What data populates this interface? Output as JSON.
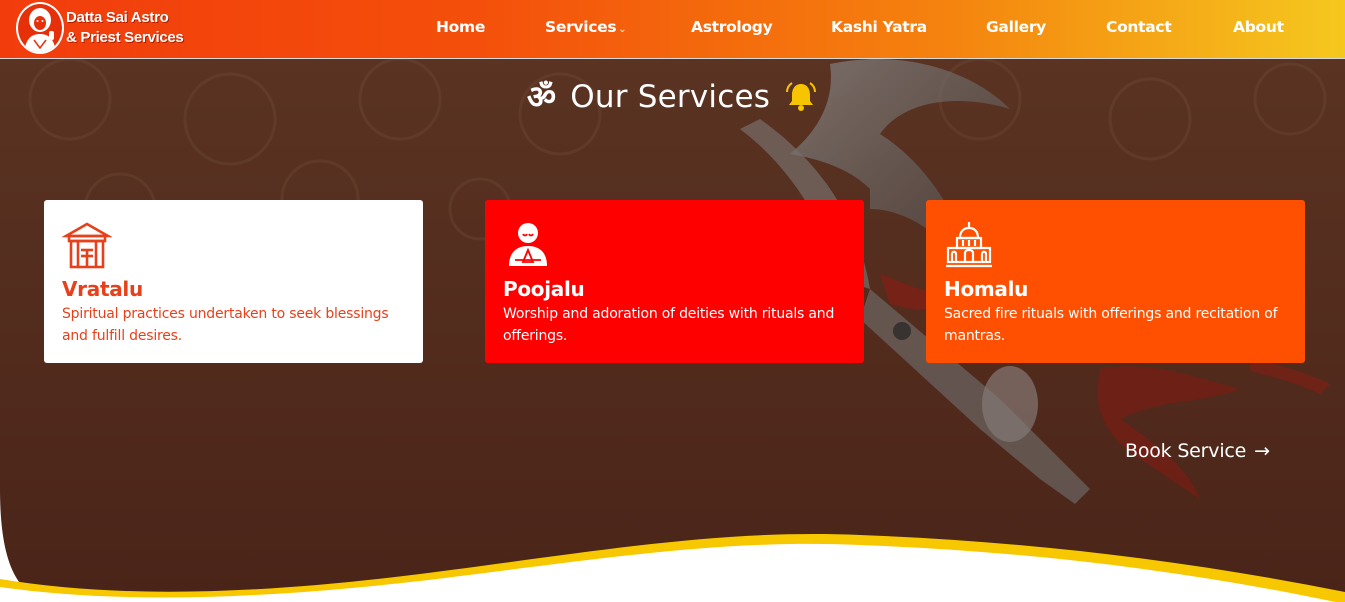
{
  "brand": {
    "line1": "Datta Sai Astro",
    "line2": "& Priest Services",
    "logo_icon": "saint-portrait-icon"
  },
  "nav": {
    "home": "Home",
    "services": "Services",
    "services_caret": "⌄",
    "astrology": "Astrology",
    "kashi_yatra": "Kashi Yatra",
    "gallery": "Gallery",
    "contact": "Contact",
    "about": "About"
  },
  "section": {
    "om_symbol": "ॐ",
    "title": "Our Services",
    "bell_icon": "bell-icon"
  },
  "cards": [
    {
      "icon": "shrine-icon",
      "name": "Vratalu",
      "desc": "Spiritual practices undertaken to seek blessings and fulfill desires."
    },
    {
      "icon": "praying-person-icon",
      "name": "Poojalu",
      "desc": "Worship and adoration of deities with rituals and offerings."
    },
    {
      "icon": "temple-icon",
      "name": "Homalu",
      "desc": "Sacred fire rituals with offerings and recitation of mantras."
    }
  ],
  "cta": {
    "label": "Book Service",
    "arrow": "→"
  },
  "colors": {
    "nav_gradient_start": "#f23c0c",
    "nav_gradient_end": "#f5c81e",
    "hero_bg": "#4f2a1e",
    "card_white": "#ffffff",
    "card_red": "#fe0000",
    "card_orange": "#fe5000",
    "accent_text": "#e8401a",
    "wave_yellow": "#f7c800"
  }
}
